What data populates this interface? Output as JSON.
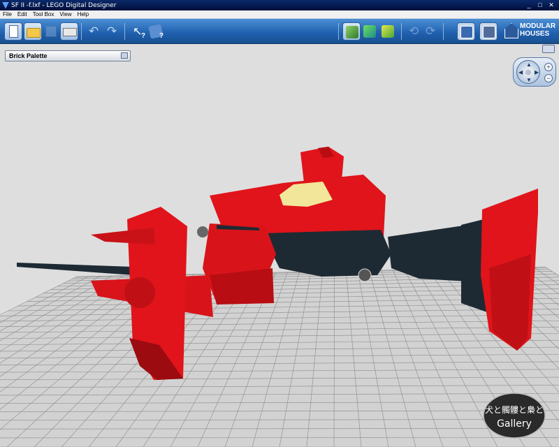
{
  "window": {
    "title": "SF II -f.lxf - LEGO Digital Designer",
    "minimize": "_",
    "maximize": "□",
    "close": "✕"
  },
  "menu": [
    "File",
    "Edit",
    "Tool Box",
    "View",
    "Help"
  ],
  "toolbar": {
    "buttons": [
      {
        "name": "new-file-button",
        "icon": "new-document-icon"
      },
      {
        "name": "open-file-button",
        "icon": "folder-icon"
      },
      {
        "name": "save-file-button",
        "icon": "save-icon"
      },
      {
        "name": "print-button",
        "icon": "printer-icon"
      },
      {
        "name": "undo-button",
        "icon": "undo-icon"
      },
      {
        "name": "redo-button",
        "icon": "redo-icon"
      },
      {
        "name": "help-select-button",
        "icon": "cursor-help-icon"
      },
      {
        "name": "help-book-button",
        "icon": "book-help-icon"
      },
      {
        "name": "build-mode-button",
        "icon": "build-mode-icon"
      },
      {
        "name": "view-mode-button",
        "icon": "view-mode-icon"
      },
      {
        "name": "building-guide-button",
        "icon": "building-guide-icon"
      }
    ],
    "theme_label_line1": "MODULAR",
    "theme_label_line2": "HOUSES"
  },
  "palette": {
    "label": "Brick Palette"
  },
  "navigation": {
    "zoom_in": "+",
    "zoom_out": "−"
  },
  "watermark": {
    "line1": "犬と髑髏と梟と",
    "line2": "Gallery"
  },
  "colors": {
    "brick_red": "#e0141a",
    "dark_red": "#9c0b10",
    "dark_blue": "#1e2a33",
    "canopy": "#f2e69a",
    "grid_line": "#8a8a8a",
    "toolbar_blue": "#2b6cb8"
  }
}
